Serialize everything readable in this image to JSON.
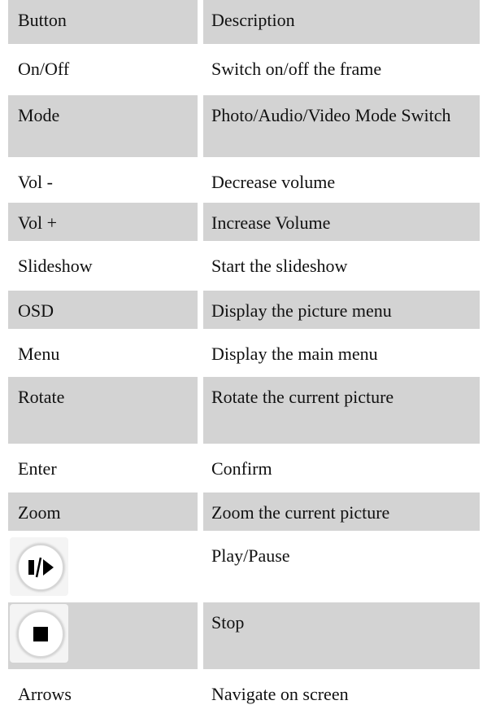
{
  "table": {
    "headers": [
      "Button",
      "Description"
    ],
    "rows": [
      {
        "button": "On/Off",
        "description": "Switch on/off the frame"
      },
      {
        "button": "Mode",
        "description": "Photo/Audio/Video Mode Switch"
      },
      {
        "button": "Vol -",
        "description": "Decrease volume"
      },
      {
        "button": "Vol +",
        "description": "Increase Volume"
      },
      {
        "button": "Slideshow",
        "description": "Start the slideshow"
      },
      {
        "button": "OSD",
        "description": "Display the picture menu"
      },
      {
        "button": "Menu",
        "description": "Display the main menu"
      },
      {
        "button": "Rotate",
        "description": "Rotate the current picture"
      },
      {
        "button": "Enter",
        "description": "Confirm"
      },
      {
        "button": "Zoom",
        "description": "Zoom the current picture"
      },
      {
        "button_icon": "play-pause-icon",
        "description": "Play/Pause"
      },
      {
        "button_icon": "stop-icon",
        "description": "Stop"
      },
      {
        "button": "Arrows",
        "description": "Navigate on screen"
      }
    ]
  },
  "colors": {
    "row_shade": "#d3d3d3",
    "background": "#ffffff",
    "text": "#111111"
  }
}
